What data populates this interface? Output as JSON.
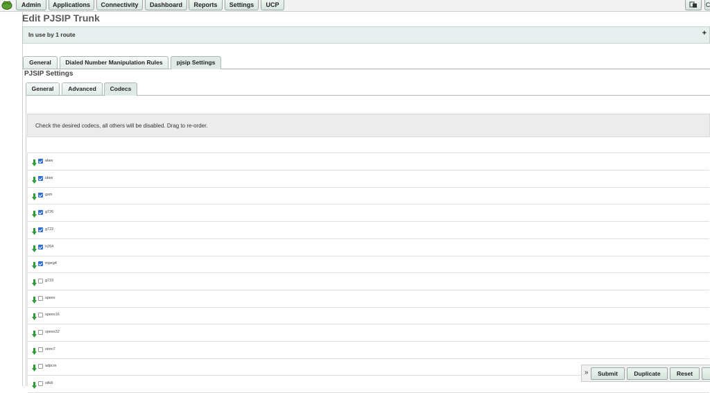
{
  "nav": {
    "items": [
      "Admin",
      "Applications",
      "Connectivity",
      "Dashboard",
      "Reports",
      "Settings",
      "UCP"
    ],
    "right_icon": "language-icon",
    "right_partial": "C"
  },
  "page_title": "Edit PJSIP Trunk",
  "in_use": {
    "label": "In use by 1 route",
    "expand_icon": "+"
  },
  "tabs": [
    "General",
    "Dialed Number Manipulation Rules",
    "pjsip Settings"
  ],
  "section_title": "PJSIP Settings",
  "subtabs": [
    "General",
    "Advanced",
    "Codecs"
  ],
  "notice": "Check the desired codecs, all others will be disabled. Drag to re-order.",
  "codecs": [
    {
      "name": "alaw",
      "checked": true
    },
    {
      "name": "ulaw",
      "checked": true
    },
    {
      "name": "gsm",
      "checked": true
    },
    {
      "name": "g726",
      "checked": true
    },
    {
      "name": "g722",
      "checked": true
    },
    {
      "name": "h264",
      "checked": true
    },
    {
      "name": "mpeg4",
      "checked": true
    },
    {
      "name": "g723",
      "checked": false
    },
    {
      "name": "speex",
      "checked": false
    },
    {
      "name": "speex16",
      "checked": false
    },
    {
      "name": "speex32",
      "checked": false
    },
    {
      "name": "siren7",
      "checked": false
    },
    {
      "name": "adpcm",
      "checked": false
    },
    {
      "name": "silk8",
      "checked": false
    }
  ],
  "actions": {
    "collapse": "»",
    "submit": "Submit",
    "duplicate": "Duplicate",
    "reset": "Reset"
  },
  "colors": {
    "accent": "#2f6fd6",
    "handle": "#2e9a3a",
    "button": "#d7e5de"
  }
}
